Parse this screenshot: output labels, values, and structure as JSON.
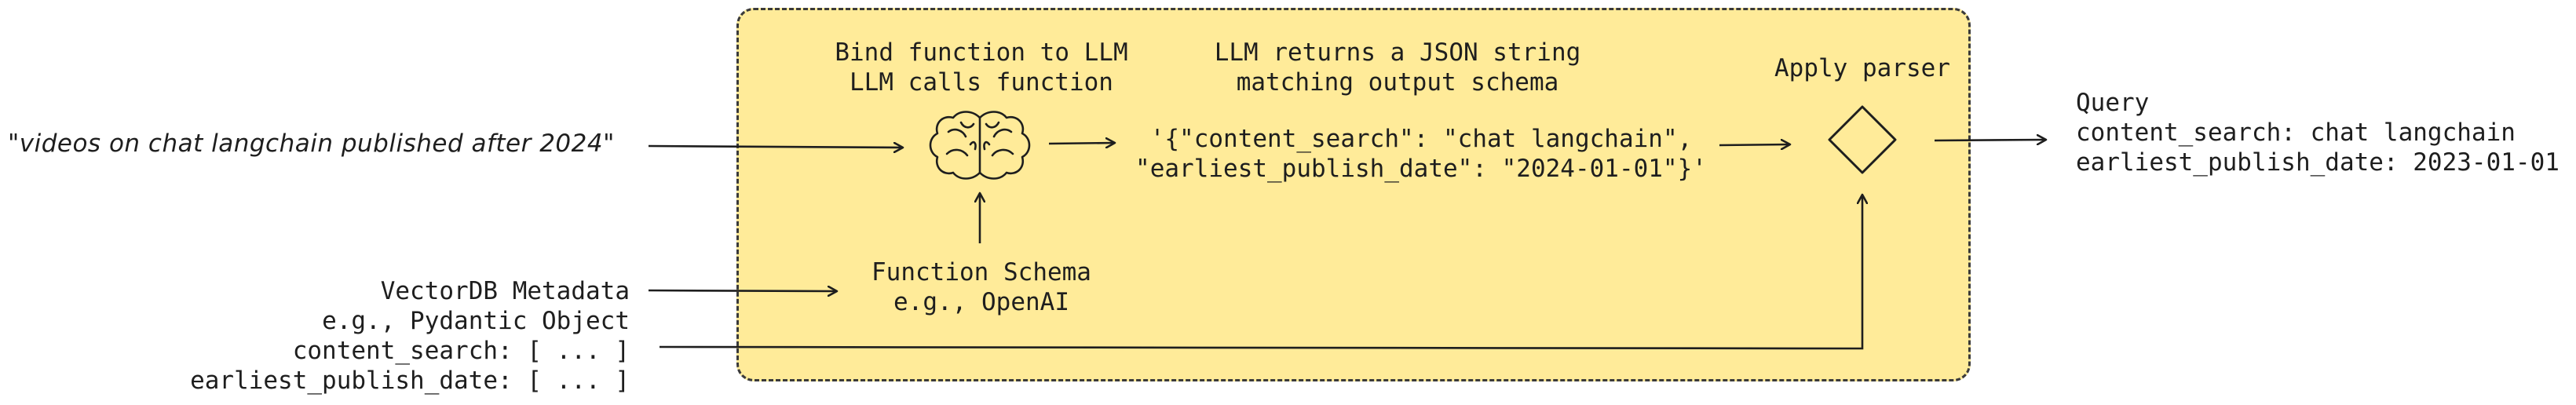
{
  "user_query": "\"videos on chat langchain published after 2024\"",
  "bind_step": {
    "line1": "Bind function to LLM",
    "line2": "LLM calls function"
  },
  "llm_returns": {
    "line1": "LLM returns a JSON string",
    "line2": "matching output schema"
  },
  "json_output": {
    "line1": "'{\"content_search\": \"chat langchain\",",
    "line2": "\"earliest_publish_date\": \"2024-01-01\"}'"
  },
  "apply_parser": "Apply parser",
  "function_schema": {
    "line1": "Function Schema",
    "line2": "e.g., OpenAI"
  },
  "metadata": {
    "line1": "VectorDB Metadata",
    "line2": "e.g., Pydantic Object",
    "line3": "content_search: [ ... ]",
    "line4": "earliest_publish_date: [ ... ]"
  },
  "query_output": {
    "title": "Query",
    "line1": "content_search: chat langchain",
    "line2": "earliest_publish_date: 2023-01-01"
  },
  "icons": {
    "llm": "brain-icon",
    "parser": "diamond-icon"
  },
  "colors": {
    "panel_fill": "#ffeb99",
    "stroke": "#1e1e1e"
  }
}
